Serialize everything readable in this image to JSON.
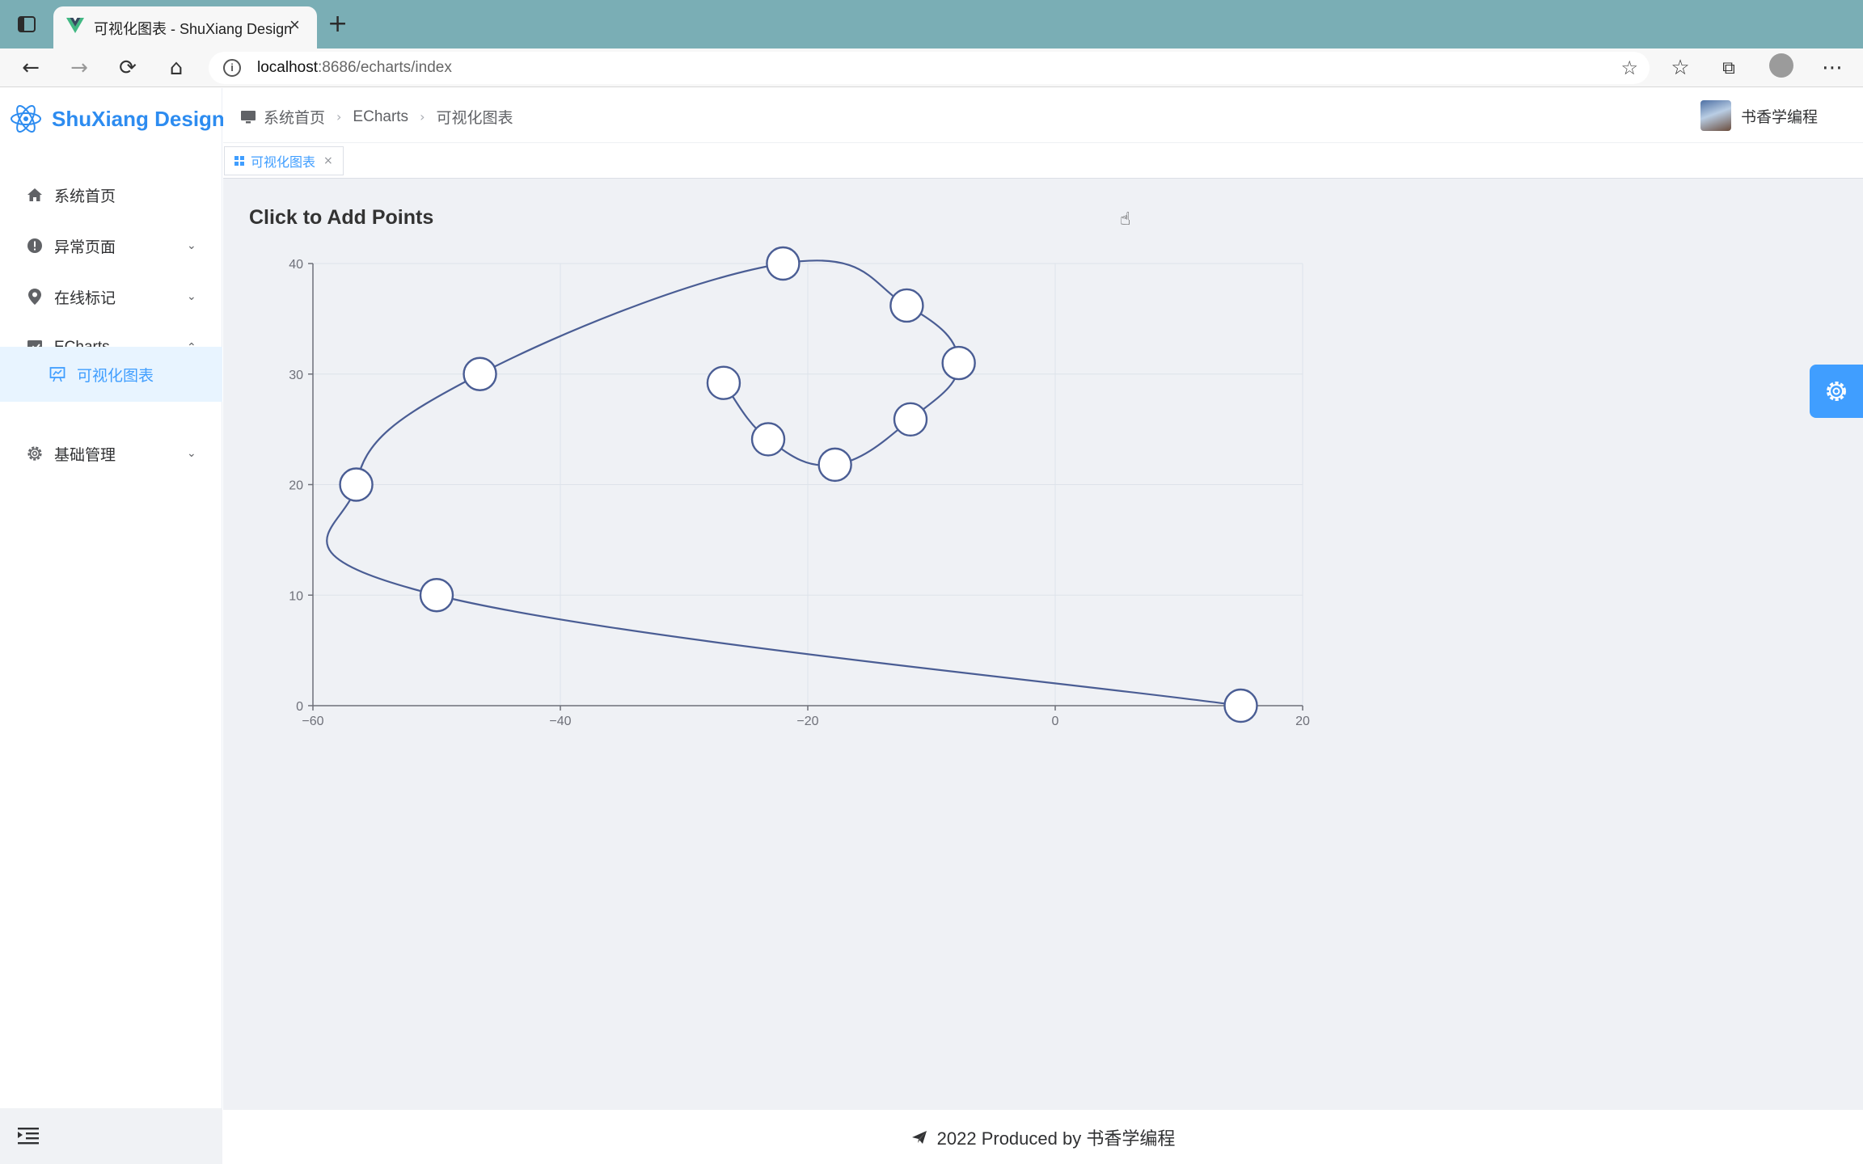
{
  "browser": {
    "tab_title": "可视化图表 - ShuXiang Design",
    "url_host": "localhost",
    "url_rest": ":8686/echarts/index"
  },
  "sidebar": {
    "logo_text": "ShuXiang Design",
    "items": [
      {
        "label": "系统首页",
        "icon": "home-icon"
      },
      {
        "label": "异常页面",
        "icon": "exclamation-icon"
      },
      {
        "label": "在线标记",
        "icon": "location-pin-icon"
      },
      {
        "label": "ECharts",
        "icon": "chart-icon"
      },
      {
        "label": "可视化图表",
        "icon": "presentation-icon"
      },
      {
        "label": "基础管理",
        "icon": "gear-icon"
      }
    ]
  },
  "header": {
    "breadcrumb": [
      "系统首页",
      "ECharts",
      "可视化图表"
    ],
    "username": "书香学编程"
  },
  "tags": {
    "active_label": "可视化图表"
  },
  "footer": {
    "text": "2022 Produced by 书香学编程"
  },
  "colors": {
    "accent": "#409eff",
    "series": "#4a5d94",
    "brand": "#2d8cf0"
  },
  "chart_data": {
    "type": "line",
    "title": "Click to Add Points",
    "smooth": true,
    "xlim": [
      -60,
      20
    ],
    "ylim": [
      0,
      40
    ],
    "xticks": [
      -60,
      -40,
      -20,
      0,
      20
    ],
    "yticks": [
      0,
      10,
      20,
      30,
      40
    ],
    "grid": true,
    "series": [
      {
        "points": [
          [
            15,
            0
          ],
          [
            -50,
            10
          ],
          [
            -56.5,
            20
          ],
          [
            -46.5,
            30
          ],
          [
            -22,
            40
          ],
          [
            -12,
            36.2
          ],
          [
            -7.8,
            31
          ],
          [
            -11.7,
            25.9
          ],
          [
            -17.8,
            21.8
          ],
          [
            -23.2,
            24.1
          ],
          [
            -26.8,
            29.2
          ]
        ]
      }
    ]
  }
}
